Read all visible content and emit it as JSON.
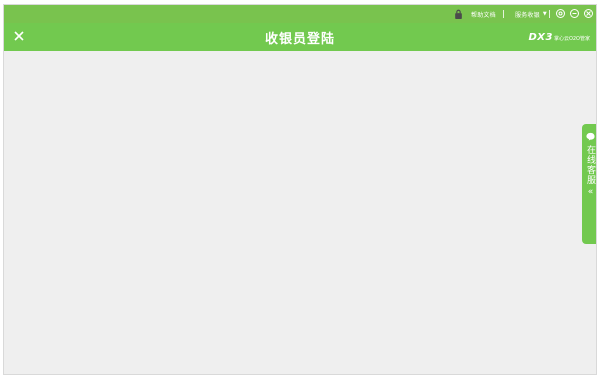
{
  "topbar": {
    "help_label": "帮助文档",
    "service_label": "服务收银",
    "dropdown_glyph": "▼"
  },
  "titlebar": {
    "title": "收银员登陆",
    "brand_logo": "DX3",
    "brand_sub": "掌心云O2O管家"
  },
  "side_tab": {
    "label": "在线客服",
    "arrow": "«"
  },
  "colors": {
    "topbar": "#79c34e",
    "titlebar": "#72c94f",
    "content_bg": "#efefef"
  }
}
